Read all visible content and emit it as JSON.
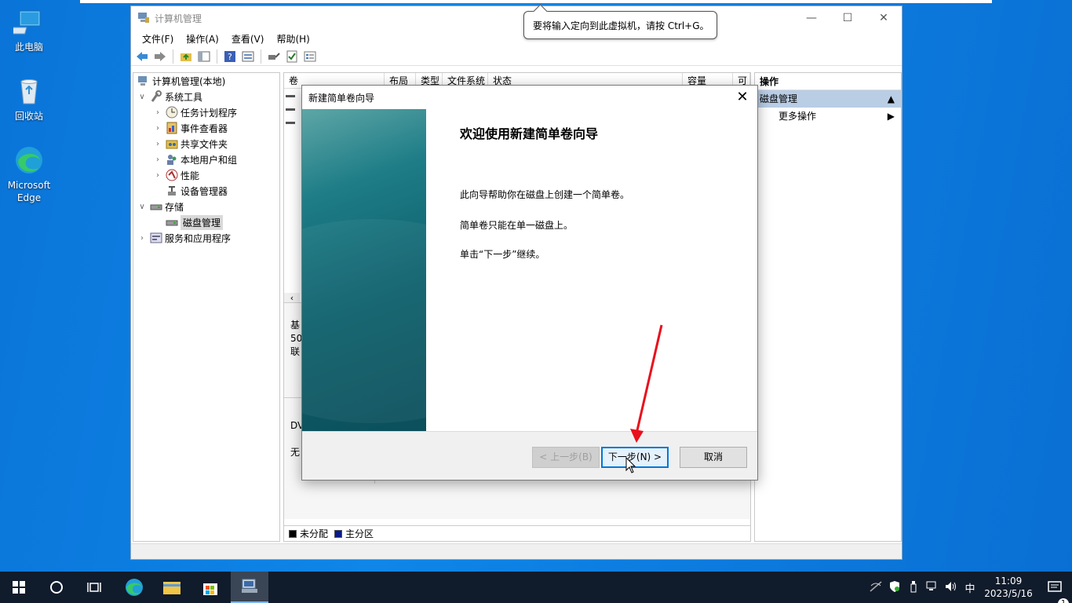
{
  "desktop": {
    "icons": [
      {
        "label": "此电脑"
      },
      {
        "label": "回收站"
      },
      {
        "label": "Microsoft Edge"
      }
    ]
  },
  "window": {
    "title": "计算机管理",
    "menu": [
      "文件(F)",
      "操作(A)",
      "查看(V)",
      "帮助(H)"
    ],
    "tree": [
      {
        "label": "计算机管理(本地)",
        "level": 0
      },
      {
        "label": "系统工具",
        "level": 1
      },
      {
        "label": "任务计划程序",
        "level": 2
      },
      {
        "label": "事件查看器",
        "level": 2
      },
      {
        "label": "共享文件夹",
        "level": 2
      },
      {
        "label": "本地用户和组",
        "level": 2
      },
      {
        "label": "性能",
        "level": 2
      },
      {
        "label": "设备管理器",
        "level": 2
      },
      {
        "label": "存储",
        "level": 1
      },
      {
        "label": "磁盘管理",
        "level": 2
      },
      {
        "label": "服务和应用程序",
        "level": 1
      }
    ],
    "columns": [
      "卷",
      "布局",
      "类型",
      "文件系统",
      "状态",
      "容量",
      "可"
    ],
    "lower_labels": [
      "基",
      "50",
      "联",
      "DV",
      "无"
    ],
    "legend": {
      "unallocated": "未分配",
      "primary": "主分区"
    },
    "actions": {
      "header": "操作",
      "section": "磁盘管理",
      "more": "更多操作"
    }
  },
  "tooltip": "要将输入定向到此虚拟机，请按 Ctrl+G。",
  "dialog": {
    "title": "新建简单卷向导",
    "heading": "欢迎使用新建简单卷向导",
    "p1": "此向导帮助你在磁盘上创建一个简单卷。",
    "p2": "简单卷只能在单一磁盘上。",
    "p3": "单击“下一步”继续。",
    "back": "< 上一步(B)",
    "next": "下一步(N) >",
    "cancel": "取消"
  },
  "taskbar": {
    "ime": "中",
    "time": "11:09",
    "date": "2023/5/16",
    "notif_count": "1"
  },
  "colors": {
    "accent": "#0078d7",
    "annotation_arrow": "#e8101c"
  }
}
